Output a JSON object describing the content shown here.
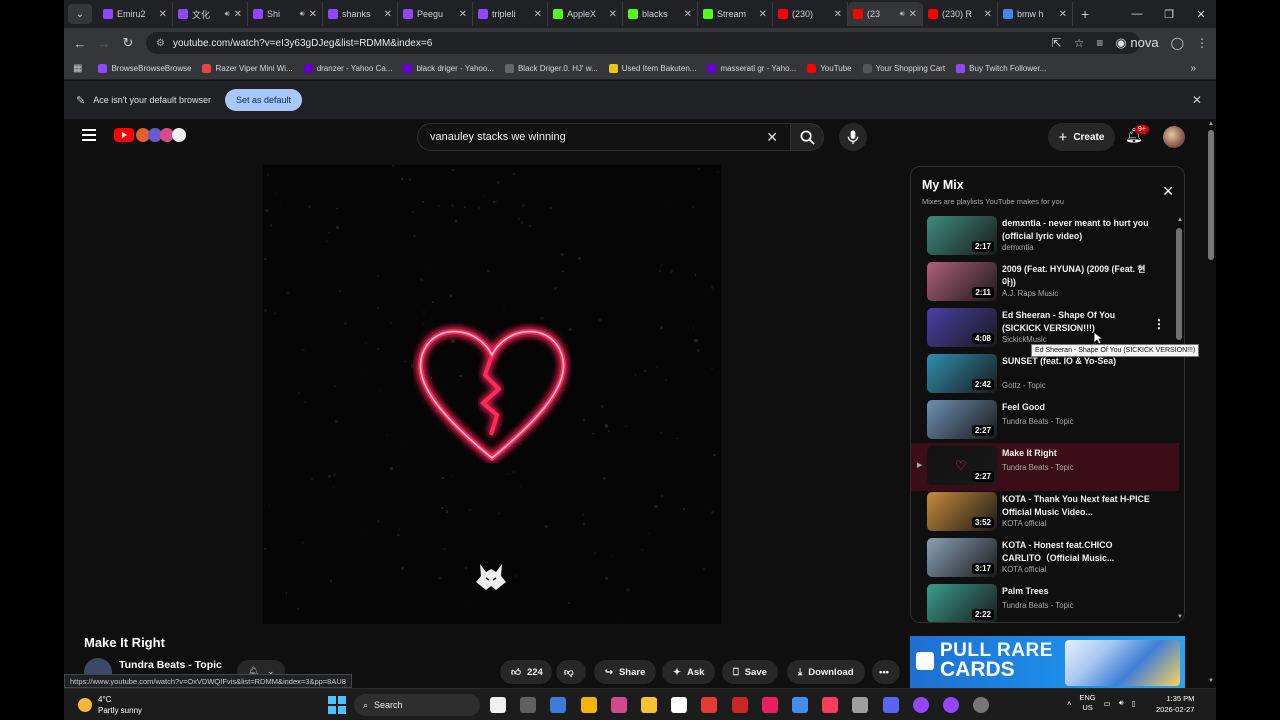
{
  "browser": {
    "tabs": [
      {
        "title": "Emiru2",
        "color": "#9146ff",
        "sound": false
      },
      {
        "title": "文化",
        "color": "#9146ff",
        "sound": true
      },
      {
        "title": "Shi",
        "color": "#9146ff",
        "sound": true
      },
      {
        "title": "shanks",
        "color": "#9146ff",
        "sound": false
      },
      {
        "title": "Peegu",
        "color": "#9146ff",
        "sound": false
      },
      {
        "title": "tripleli",
        "color": "#9146ff",
        "sound": false
      },
      {
        "title": "AppleX",
        "color": "#53fc18",
        "sound": false
      },
      {
        "title": "blacks",
        "color": "#53fc18",
        "sound": false
      },
      {
        "title": "Stream",
        "color": "#53fc18",
        "sound": false
      },
      {
        "title": "(230)",
        "color": "#ff0000",
        "sound": false
      },
      {
        "title": "(23",
        "color": "#ff0000",
        "sound": true,
        "active": true
      },
      {
        "title": "(230) R",
        "color": "#ff0000",
        "sound": false
      },
      {
        "title": "bmw h",
        "color": "#4285f4",
        "sound": false
      }
    ],
    "new_tab": "+",
    "url": "youtube.com/watch?v=eI3y63gDJeg&list=RDMM&index=6",
    "nova_label": "nova",
    "bookmarks": [
      {
        "label": "BrowseBrowseBrowse",
        "color": "#9146ff"
      },
      {
        "label": "Razer Viper Mini Wi...",
        "color": "#e8453c"
      },
      {
        "label": "dranzer - Yahoo Ca...",
        "color": "#6001d2"
      },
      {
        "label": "black driger - Yahoo...",
        "color": "#6001d2"
      },
      {
        "label": "Black Driger.0. HJ' w...",
        "color": "#666666"
      },
      {
        "label": "Used Item Bakuten...",
        "color": "#f1c40f"
      },
      {
        "label": "masserati gr - Yaho...",
        "color": "#6001d2"
      },
      {
        "label": "YouTube",
        "color": "#ff0000"
      },
      {
        "label": "Your Shopping Cart",
        "color": "#555555"
      },
      {
        "label": "Buy Twitch Follower...",
        "color": "#9146ff"
      }
    ],
    "infobar_text": "Ace isn't your default browser",
    "infobar_button": "Set as default",
    "status_url": "https://www.youtube.com/watch?v=OxVDWQIFvis&list=RDMM&index=3&pp=8AU8"
  },
  "youtube": {
    "search_value": "vanauley stacks we winning",
    "create_label": "Create",
    "notif_badge": "9+",
    "video_title": "Make It Right",
    "channel_name": "Tundra Beats - Topic",
    "actions": {
      "likes": "224",
      "share": "Share",
      "ask": "Ask",
      "save": "Save",
      "download": "Download"
    },
    "mix": {
      "title": "My Mix",
      "subtitle": "Mixes are playlists YouTube makes for you",
      "items": [
        {
          "title": "demxntia - never meant to hurt you (official lyric video)",
          "channel": "demxntia",
          "duration": "2:17",
          "thumb": "#3f8c7c"
        },
        {
          "title": "2009 (Feat. HYUNA) (2009 (Feat. 현아))",
          "channel": "A.J. Raps Music",
          "duration": "2:11",
          "thumb": "#b0607a"
        },
        {
          "title": "Ed Sheeran - Shape Of You (SICKICK VERSION!!!)",
          "channel": "SickickMusic",
          "duration": "4:08",
          "thumb": "#4a3fa8"
        },
        {
          "title": "SUNSET (feat. IO & Yo-Sea)",
          "channel": "Gottz - Topic",
          "duration": "2:42",
          "thumb": "#2d8fb0"
        },
        {
          "title": "Feel Good",
          "channel": "Tundra Beats - Topic",
          "duration": "2:27",
          "thumb": "#6e8fb4"
        },
        {
          "title": "Make It Right",
          "channel": "Tundra Beats - Topic",
          "duration": "2:27",
          "thumb": "#111111",
          "current": true
        },
        {
          "title": "KOTA - Thank You Next feat H-PICE　Official Music Video...",
          "channel": "KOTA official",
          "duration": "3:52",
          "thumb": "#c98a3a"
        },
        {
          "title": "KOTA - Honest feat.CHICO CARLITO（Official Music...",
          "channel": "KOTA official",
          "duration": "3:17",
          "thumb": "#8aa0b8"
        },
        {
          "title": "Palm Trees",
          "channel": "Tundra Beats - Topic",
          "duration": "2:22",
          "thumb": "#3a9c8c"
        }
      ],
      "tooltip": "Ed Sheeran - Shape Of You (SICKICK VERSION!!!)"
    },
    "ad": {
      "line1": "PULL RARE",
      "line2": "CARDS"
    }
  },
  "taskbar": {
    "temperature": "4°C",
    "weather": "Partly sunny",
    "search_label": "Search",
    "lang": "ENG",
    "region": "US",
    "time": "1:35 PM",
    "date": "2026-02-27"
  }
}
